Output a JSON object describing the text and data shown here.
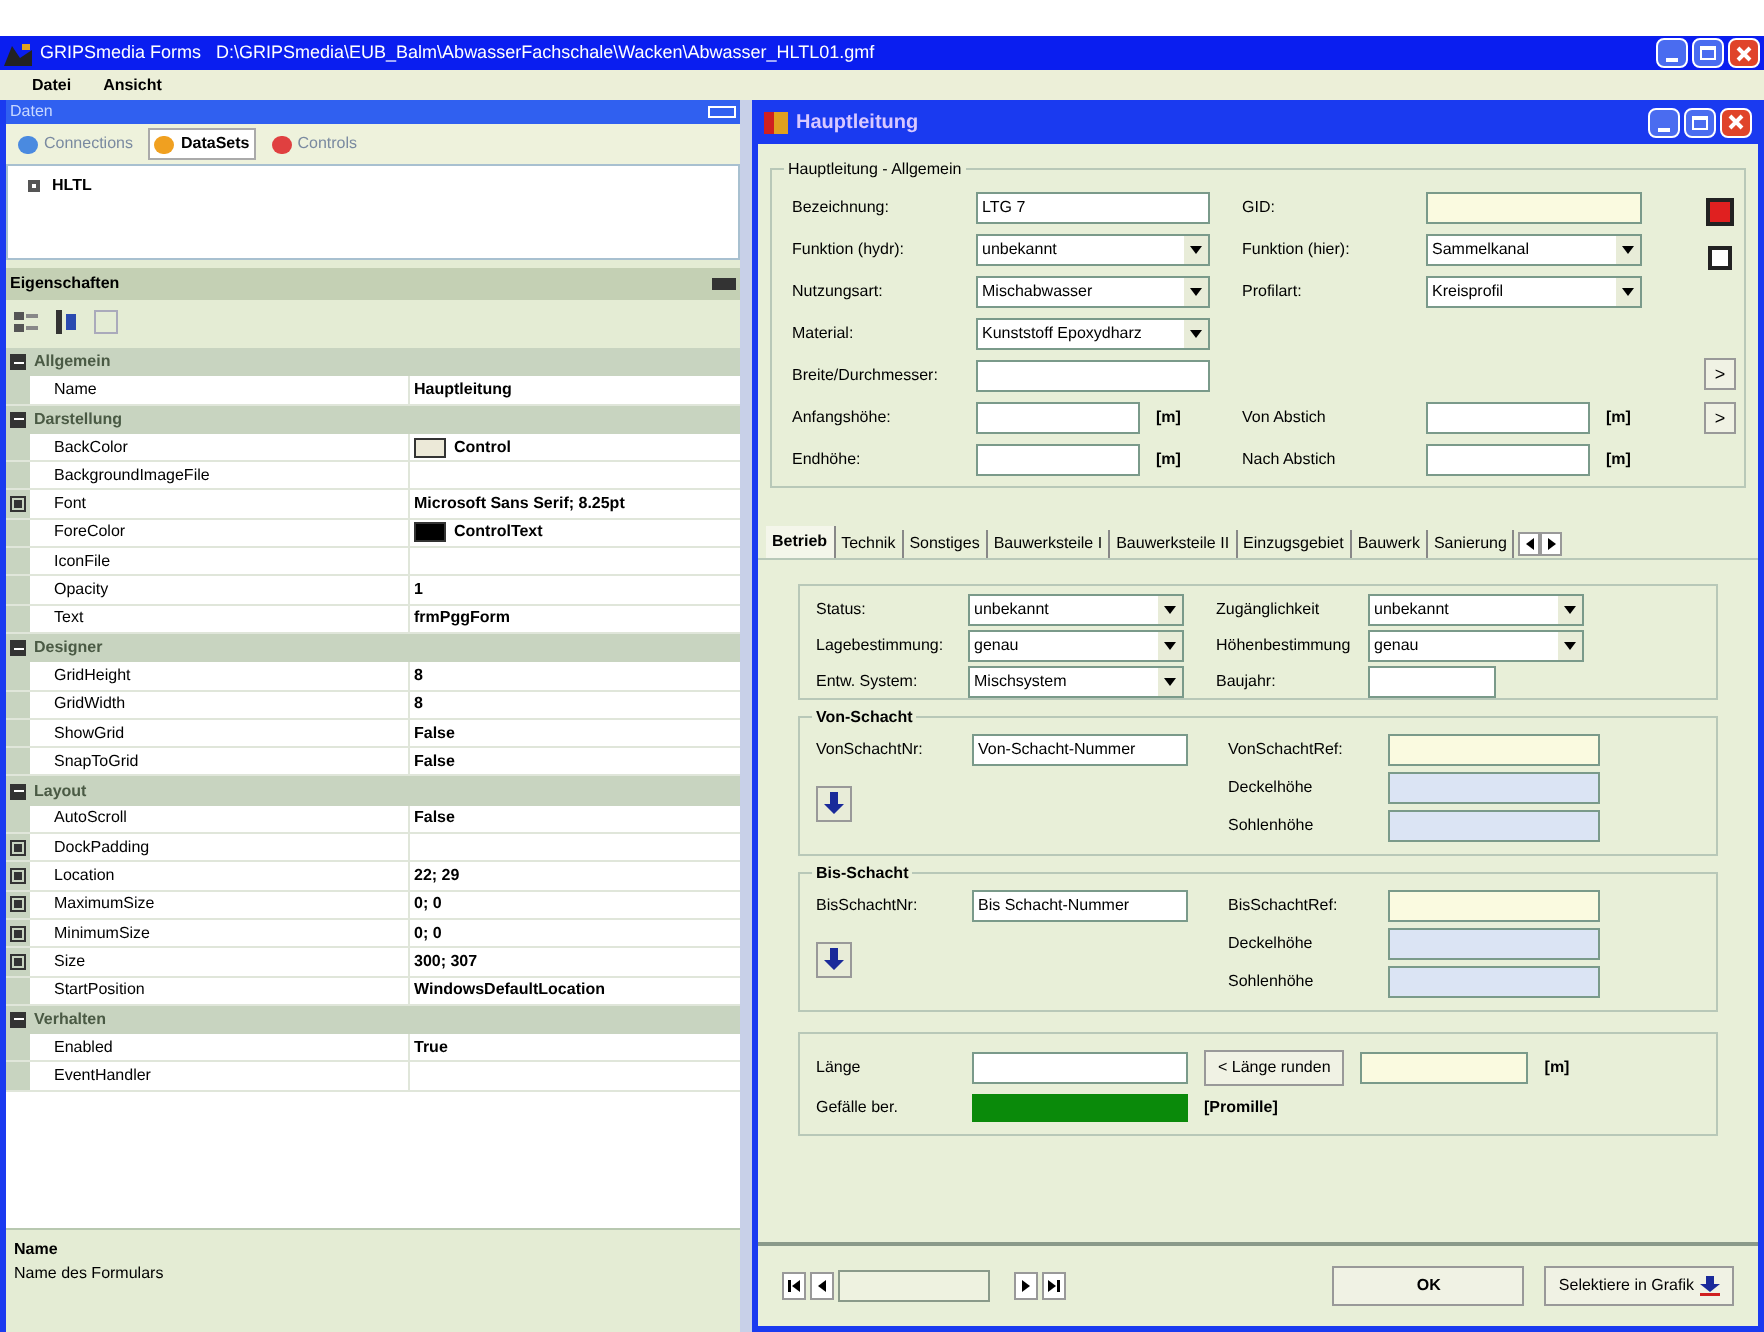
{
  "window": {
    "title": "GRIPSmedia Forms   D:\\GRIPSmedia\\EUB_Balm\\AbwasserFachschale\\Wacken\\Abwasser_HLTL01.gmf"
  },
  "menu": [
    "Datei",
    "Ansicht"
  ],
  "data_panel": {
    "title": "Daten",
    "tabs": [
      {
        "label": "Connections",
        "selected": false
      },
      {
        "label": "DataSets",
        "selected": true
      },
      {
        "label": "Controls",
        "selected": false
      }
    ],
    "tree": [
      {
        "label": "HLTL",
        "expanded": false
      }
    ]
  },
  "properties_panel": {
    "title": "Eigenschaften",
    "rows": [
      {
        "kind": "category",
        "name": "Allgemein",
        "expanded": true
      },
      {
        "kind": "property",
        "name": "Name",
        "value": "Hauptleitung"
      },
      {
        "kind": "category",
        "name": "Darstellung",
        "expanded": true
      },
      {
        "kind": "property",
        "name": "BackColor",
        "value": "Control",
        "color": "#ece9d8"
      },
      {
        "kind": "property",
        "name": "BackgroundImageFile",
        "value": ""
      },
      {
        "kind": "property",
        "name": "Font",
        "value": "Microsoft Sans Serif; 8.25pt",
        "expanded": false
      },
      {
        "kind": "property",
        "name": "ForeColor",
        "value": "ControlText",
        "color": "#000000"
      },
      {
        "kind": "property",
        "name": "IconFile",
        "value": ""
      },
      {
        "kind": "property",
        "name": "Opacity",
        "value": "1"
      },
      {
        "kind": "property",
        "name": "Text",
        "value": "frmPggForm"
      },
      {
        "kind": "category",
        "name": "Designer",
        "expanded": true
      },
      {
        "kind": "property",
        "name": "GridHeight",
        "value": "8"
      },
      {
        "kind": "property",
        "name": "GridWidth",
        "value": "8"
      },
      {
        "kind": "property",
        "name": "ShowGrid",
        "value": "False"
      },
      {
        "kind": "property",
        "name": "SnapToGrid",
        "value": "False"
      },
      {
        "kind": "category",
        "name": "Layout",
        "expanded": true
      },
      {
        "kind": "property",
        "name": "AutoScroll",
        "value": "False"
      },
      {
        "kind": "property",
        "name": "DockPadding",
        "value": "",
        "expanded": false
      },
      {
        "kind": "property",
        "name": "Location",
        "value": "22; 29",
        "expanded": false
      },
      {
        "kind": "property",
        "name": "MaximumSize",
        "value": "0; 0",
        "expanded": false
      },
      {
        "kind": "property",
        "name": "MinimumSize",
        "value": "0; 0",
        "expanded": false
      },
      {
        "kind": "property",
        "name": "Size",
        "value": "300; 307",
        "expanded": false
      },
      {
        "kind": "property",
        "name": "StartPosition",
        "value": "WindowsDefaultLocation"
      },
      {
        "kind": "category",
        "name": "Verhalten",
        "expanded": true
      },
      {
        "kind": "property",
        "name": "Enabled",
        "value": "True"
      },
      {
        "kind": "property",
        "name": "EventHandler",
        "value": ""
      }
    ],
    "description": {
      "title": "Name",
      "text": "Name des Formulars"
    }
  },
  "dialog": {
    "title": "Hauptleitung",
    "general": {
      "title": "Hauptleitung - Allgemein",
      "rows": [
        [
          {
            "label": "Bezeichnung:",
            "kind": "text",
            "value": "LTG 7"
          },
          {
            "label": "GID:",
            "kind": "text",
            "color": "#fafae0"
          }
        ],
        [
          {
            "label": "Funktion (hydr):",
            "kind": "combo",
            "value": "unbekannt"
          },
          {
            "label": "Funktion (hier):",
            "kind": "combo",
            "value": "Sammelkanal"
          }
        ],
        [
          {
            "label": "Nutzungsart:",
            "kind": "combo",
            "value": "Mischabwasser"
          },
          {
            "label": "Profilart:",
            "kind": "combo",
            "value": "Kreisprofil"
          }
        ],
        [
          {
            "label": "Material:",
            "kind": "combo",
            "value": "Kunststoff Epoxydharz"
          }
        ],
        [
          {
            "label": "Breite/Durchmesser:",
            "kind": "text"
          }
        ],
        [
          {
            "label": "Anfangshöhe:",
            "kind": "text",
            "unit": "[m]"
          },
          {
            "label": "Von Abstich",
            "kind": "text",
            "unit": "[m]"
          }
        ],
        [
          {
            "label": "Endhöhe:",
            "kind": "text",
            "unit": "[m]"
          },
          {
            "label": "Nach Abstich",
            "kind": "text",
            "unit": "[m]"
          }
        ]
      ],
      "side_buttons": [
        ">",
        ">"
      ]
    },
    "tabs": [
      {
        "label": "Betrieb",
        "selected": true
      },
      {
        "label": "Technik",
        "selected": false
      },
      {
        "label": "Sonstiges",
        "selected": false
      },
      {
        "label": "Bauwerksteile I",
        "selected": false
      },
      {
        "label": "Bauwerksteile II",
        "selected": false
      },
      {
        "label": "Einzugsgebiet",
        "selected": false
      },
      {
        "label": "Bauwerk",
        "selected": false
      },
      {
        "label": "Sanierung",
        "selected": false
      }
    ],
    "status_rows": [
      [
        {
          "label": "Status:",
          "kind": "combo",
          "value": "unbekannt"
        },
        {
          "label": "Zugänglichkeit",
          "kind": "combo",
          "value": "unbekannt"
        }
      ],
      [
        {
          "label": "Lagebestimmung:",
          "kind": "combo",
          "value": "genau"
        },
        {
          "label": "Höhenbestimmung",
          "kind": "combo",
          "value": "genau"
        }
      ],
      [
        {
          "label": "Entw. System:",
          "kind": "combo",
          "value": "Mischsystem"
        },
        {
          "label": "Baujahr:",
          "kind": "text"
        }
      ]
    ],
    "shafts": [
      {
        "title": "Von-Schacht",
        "nr_label": "VonSchachtNr:",
        "nr_value": "Von-Schacht-Nummer",
        "fields": [
          {
            "label": "VonSchachtRef:",
            "color": "#fafae0"
          },
          {
            "label": "Deckelhöhe",
            "color": "#dbe4f4"
          },
          {
            "label": "Sohlenhöhe",
            "color": "#dbe4f4"
          }
        ]
      },
      {
        "title": "Bis-Schacht",
        "nr_label": "BisSchachtNr:",
        "nr_value": "Bis Schacht-Nummer",
        "fields": [
          {
            "label": "BisSchachtRef:",
            "color": "#fafae0"
          },
          {
            "label": "Deckelhöhe",
            "color": "#dbe4f4"
          },
          {
            "label": "Sohlenhöhe",
            "color": "#dbe4f4"
          }
        ]
      }
    ],
    "length": {
      "label": "Länge",
      "round_button": "< Länge runden",
      "unit": "[m]"
    },
    "slope": {
      "label": "Gefälle ber.",
      "color": "#0a8a0a",
      "unit": "[Promille]"
    },
    "buttons": [
      {
        "label": "OK"
      },
      {
        "label": "Selektiere in Grafik"
      }
    ]
  }
}
